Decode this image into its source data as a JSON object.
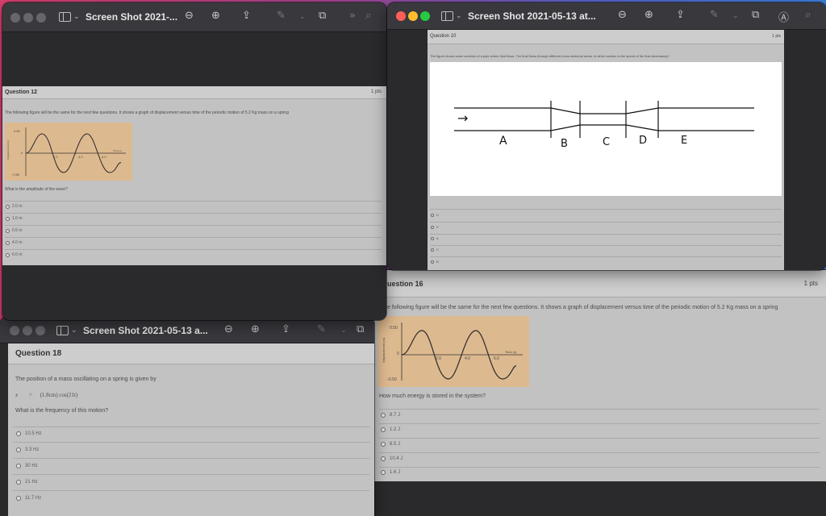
{
  "colors": {
    "traffic_red": "#fe5f57",
    "traffic_yellow": "#febc2e",
    "traffic_green": "#28c840",
    "traffic_inactive": "#67676b"
  },
  "icons": [
    "sidebar-icon",
    "chevron-down-icon",
    "zoom-out-icon",
    "zoom-in-icon",
    "share-icon",
    "markup-icon",
    "rotate-icon",
    "more-icon",
    "search-icon",
    "accessibility-icon"
  ],
  "win1": {
    "title": "Screen Shot 2021-...",
    "question_title": "Question 12",
    "points": "1 pts",
    "prompt": "The following figure will be the same for the next few questions. It shows a graph of displacement versus time of the periodic motion of 5.2 Kg mass on a spring",
    "graph": {
      "y_top": "0.50",
      "y_bottom": "−0.50",
      "zero": "0",
      "x_ticks": [
        "2.0",
        "4.0",
        "6.0"
      ],
      "ylabel": "Displacement (m)",
      "xlabel": "Time (s)"
    },
    "question": "What is the amplitude of the wave?",
    "options": [
      "2.0 m",
      "1.0 m",
      "0.5 m",
      "4.0 m",
      "6.0 m"
    ]
  },
  "win2": {
    "title": "Screen Shot 2021-05-13 at...",
    "question_title": "Question 10",
    "points": "1 pts",
    "prompt": "The figure shows some sections of a pipe where fluid flows. The fluid flows through different cross sectional areas. In which section is the speed of the fluid decreasing?",
    "figure_labels": [
      "A",
      "B",
      "C",
      "D",
      "E"
    ],
    "arrow": "→",
    "options": [
      "D",
      "E",
      "A",
      "C",
      "B"
    ]
  },
  "win3": {
    "title": "Screen Shot 2021-05-13 a...",
    "question_title": "Question 18",
    "prompt": "The position of a mass oscillating on a spring is given by",
    "equation_lhs": "x",
    "equation_eq": "=",
    "equation_rhs": "(1.8cm) cos(21t)",
    "question": "What is the frequency of this motion?",
    "options": [
      "10.5 Hz",
      "3.3 Hz",
      "30 Hz",
      "21 Hz",
      "11.7 Hz"
    ]
  },
  "win4": {
    "question_title": "uestion 16",
    "points": "1 pts",
    "prompt": "e following figure will be the same for the next few questions. It shows a graph of displacement versus time of the periodic motion of 5.2 Kg mass on a spring",
    "graph": {
      "y_top": "0.50",
      "y_bottom": "−0.50",
      "zero": "0",
      "x_ticks": [
        "2.0",
        "4.0",
        "6.0"
      ],
      "ylabel": "Displacement (m)",
      "xlabel": "Time (s)"
    },
    "question": "How much energy is stored in the system?",
    "options": [
      "8.7 J",
      "1.2 J",
      "6.5 J",
      "10.4 J",
      "1.6 J"
    ]
  }
}
